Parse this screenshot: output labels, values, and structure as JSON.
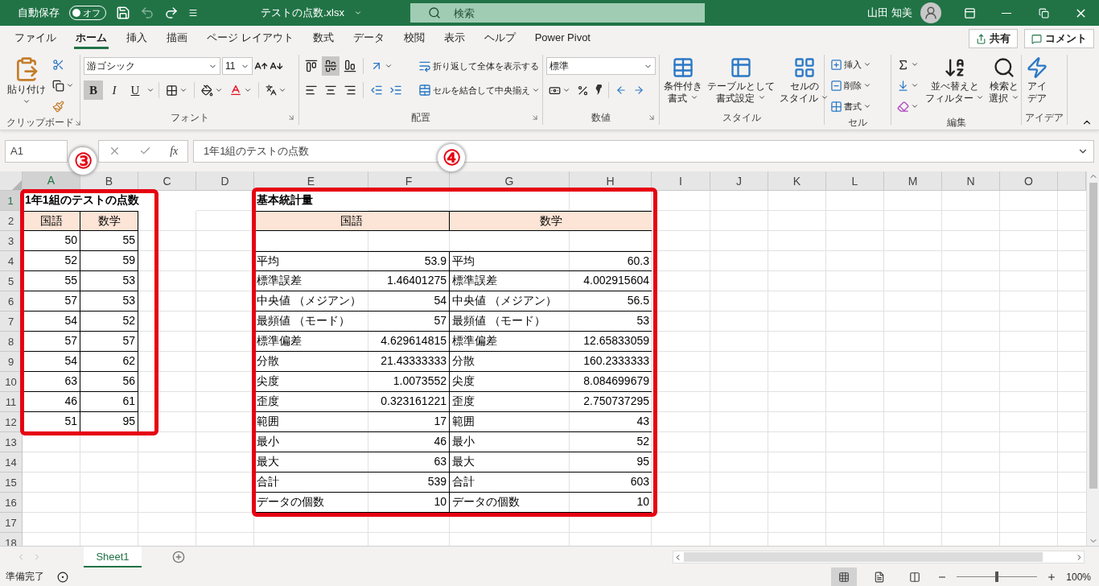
{
  "title_bar": {
    "autosave_label": "自動保存",
    "autosave": {
      "label": "オフ",
      "on": false
    },
    "filename": "テストの点数.xlsx",
    "search": {
      "placeholder": "検索"
    },
    "user": "山田 知美"
  },
  "menu_tabs": [
    {
      "label": "ファイル",
      "selected": false
    },
    {
      "label": "ホーム",
      "selected": true
    },
    {
      "label": "挿入",
      "selected": false
    },
    {
      "label": "描画",
      "selected": false
    },
    {
      "label": "ページ レイアウト",
      "selected": false
    },
    {
      "label": "数式",
      "selected": false
    },
    {
      "label": "データ",
      "selected": false
    },
    {
      "label": "校閲",
      "selected": false
    },
    {
      "label": "表示",
      "selected": false
    },
    {
      "label": "ヘルプ",
      "selected": false
    },
    {
      "label": "Power Pivot",
      "selected": false
    }
  ],
  "share_button": "共有",
  "comment_button": "コメント",
  "ribbon": {
    "clipboard": {
      "paste": "貼り付け",
      "label": "クリップボード"
    },
    "font": {
      "name": "游ゴシック",
      "size": "11",
      "styles": [
        {
          "label": "B",
          "selected": true
        },
        {
          "label": "I",
          "selected": false
        },
        {
          "label": "U",
          "selected": false
        }
      ],
      "label": "フォント"
    },
    "alignment": {
      "vertical": [
        {
          "selected": false
        },
        {
          "selected": true
        },
        {
          "selected": false
        }
      ],
      "wrap": "折り返して全体を表示する",
      "merge": "セルを結合して中央揃え",
      "label": "配置"
    },
    "number": {
      "format": "標準",
      "label": "数値"
    },
    "styles": {
      "buttons": [
        {
          "lines": [
            "条件付き",
            "書式"
          ]
        },
        {
          "lines": [
            "テーブルとして",
            "書式設定"
          ]
        },
        {
          "lines": [
            "セルの",
            "スタイル"
          ]
        }
      ],
      "label": "スタイル"
    },
    "cells": {
      "buttons": [
        "挿入",
        "削除",
        "書式"
      ],
      "label": "セル"
    },
    "editing": {
      "buttons": [
        {
          "lines": [
            "並べ替えと",
            "フィルター"
          ]
        },
        {
          "lines": [
            "検索と",
            "選択"
          ]
        }
      ],
      "label": "編集"
    },
    "ideas": {
      "button": {
        "lines": [
          "アイ",
          "デア"
        ]
      },
      "label": "アイデア"
    }
  },
  "formula_bar": {
    "name_box": "A1",
    "fx": "fx",
    "formula": "1年1組のテストの点数"
  },
  "sheet": {
    "columns": [
      {
        "label": "A",
        "selected": true
      },
      {
        "label": "B",
        "selected": false
      },
      {
        "label": "C",
        "selected": false
      },
      {
        "label": "D",
        "selected": false
      },
      {
        "label": "E",
        "selected": false
      },
      {
        "label": "F",
        "selected": false
      },
      {
        "label": "G",
        "selected": false
      },
      {
        "label": "H",
        "selected": false
      },
      {
        "label": "I",
        "selected": false
      },
      {
        "label": "J",
        "selected": false
      },
      {
        "label": "K",
        "selected": false
      },
      {
        "label": "L",
        "selected": false
      },
      {
        "label": "M",
        "selected": false
      },
      {
        "label": "N",
        "selected": false
      },
      {
        "label": "O",
        "selected": false
      }
    ],
    "rows": [
      {
        "number": "1",
        "selected": true
      },
      {
        "number": "2",
        "selected": false
      },
      {
        "number": "3",
        "selected": false
      },
      {
        "number": "4",
        "selected": false
      },
      {
        "number": "5",
        "selected": false
      },
      {
        "number": "6",
        "selected": false
      },
      {
        "number": "7",
        "selected": false
      },
      {
        "number": "8",
        "selected": false
      },
      {
        "number": "9",
        "selected": false
      },
      {
        "number": "10",
        "selected": false
      },
      {
        "number": "11",
        "selected": false
      },
      {
        "number": "12",
        "selected": false
      },
      {
        "number": "13",
        "selected": false
      },
      {
        "number": "14",
        "selected": false
      },
      {
        "number": "15",
        "selected": false
      },
      {
        "number": "16",
        "selected": false
      },
      {
        "number": "17",
        "selected": false
      },
      {
        "number": "18",
        "selected": false
      }
    ],
    "score_table": {
      "title": "1年1組のテストの点数",
      "headers": [
        "国語",
        "数学"
      ],
      "rows": [
        [
          "50",
          "55"
        ],
        [
          "52",
          "59"
        ],
        [
          "55",
          "53"
        ],
        [
          "57",
          "53"
        ],
        [
          "54",
          "52"
        ],
        [
          "57",
          "57"
        ],
        [
          "54",
          "62"
        ],
        [
          "63",
          "56"
        ],
        [
          "46",
          "61"
        ],
        [
          "51",
          "95"
        ]
      ]
    },
    "stats_table": {
      "title": "基本統計量",
      "headers": [
        "国語",
        "数学"
      ],
      "rows": [
        [
          "平均",
          "53.9",
          "平均",
          "60.3"
        ],
        [
          "標準誤差",
          "1.46401275",
          "標準誤差",
          "4.002915604"
        ],
        [
          "中央値 （メジアン）",
          "54",
          "中央値 （メジアン）",
          "56.5"
        ],
        [
          "最頻値 （モード）",
          "57",
          "最頻値 （モード）",
          "53"
        ],
        [
          "標準偏差",
          "4.629614815",
          "標準偏差",
          "12.65833059"
        ],
        [
          "分散",
          "21.43333333",
          "分散",
          "160.2333333"
        ],
        [
          "尖度",
          "1.0073552",
          "尖度",
          "8.084699679"
        ],
        [
          "歪度",
          "0.323161221",
          "歪度",
          "2.750737295"
        ],
        [
          "範囲",
          "17",
          "範囲",
          "43"
        ],
        [
          "最小",
          "46",
          "最小",
          "52"
        ],
        [
          "最大",
          "63",
          "最大",
          "95"
        ],
        [
          "合計",
          "539",
          "合計",
          "603"
        ],
        [
          "データの個数",
          "10",
          "データの個数",
          "10"
        ]
      ]
    }
  },
  "annotations": [
    {
      "label": "③"
    },
    {
      "label": "④"
    }
  ],
  "sheet_tabs": [
    {
      "label": "Sheet1",
      "selected": true
    }
  ],
  "status_bar": {
    "status": "準備完了",
    "zoom": {
      "level": 0.5,
      "reading": "100%"
    }
  }
}
